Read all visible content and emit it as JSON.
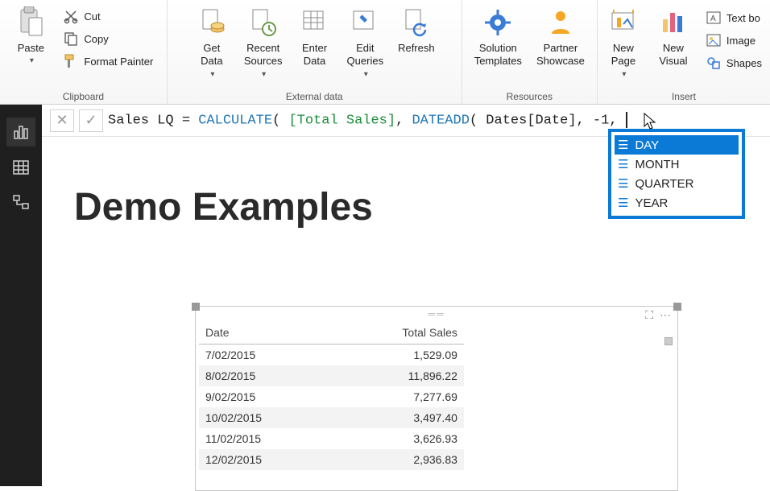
{
  "ribbon": {
    "clipboard_group": "Clipboard",
    "paste": "Paste",
    "cut": "Cut",
    "copy": "Copy",
    "format_painter": "Format Painter",
    "external_group": "External data",
    "get_data": "Get\nData",
    "recent_sources": "Recent\nSources",
    "enter_data": "Enter\nData",
    "edit_queries": "Edit\nQueries",
    "refresh": "Refresh",
    "resources_group": "Resources",
    "solution_templates": "Solution\nTemplates",
    "partner_showcase": "Partner\nShowcase",
    "insert_group": "Insert",
    "new_page": "New\nPage",
    "new_visual": "New\nVisual",
    "text_box": "Text bo",
    "image": "Image",
    "shapes": "Shapes"
  },
  "formula": {
    "prefix": "Sales LQ = ",
    "fn1": "CALCULATE",
    "p1": "( ",
    "measure": "[Total Sales]",
    "p2": ", ",
    "fn2": "DATEADD",
    "p3": "( Dates[Date], -1,"
  },
  "intellisense": {
    "items": [
      "DAY",
      "MONTH",
      "QUARTER",
      "YEAR"
    ],
    "selected_index": 0
  },
  "page_title": "Demo Examples",
  "chart_data": {
    "type": "table",
    "columns": [
      "Date",
      "Total Sales"
    ],
    "rows": [
      [
        "7/02/2015",
        "1,529.09"
      ],
      [
        "8/02/2015",
        "11,896.22"
      ],
      [
        "9/02/2015",
        "7,277.69"
      ],
      [
        "10/02/2015",
        "3,497.40"
      ],
      [
        "11/02/2015",
        "3,626.93"
      ],
      [
        "12/02/2015",
        "2,936.83"
      ]
    ]
  }
}
